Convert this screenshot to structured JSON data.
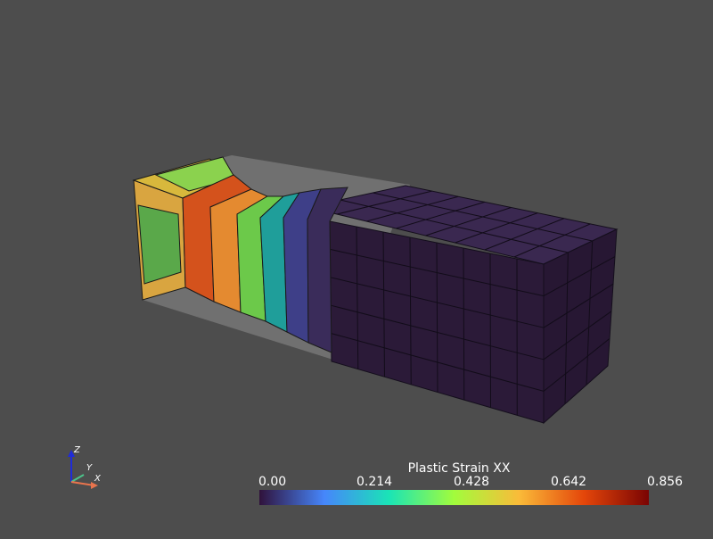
{
  "scalar_bar": {
    "title": "Plastic Strain XX",
    "ticks": [
      "0.00",
      "0.214",
      "0.428",
      "0.642",
      "0.856"
    ],
    "colors": [
      "#30123b",
      "#4686fb",
      "#1ae4b6",
      "#a2fc3c",
      "#fabb39",
      "#e4460a",
      "#7a0403"
    ]
  },
  "axes": {
    "x_label": "X",
    "y_label": "Y",
    "z_label": "Z",
    "x_color": "#e8744d",
    "y_color": "#4cc38a",
    "z_color": "#1f2bd9"
  },
  "scene": {
    "background": "#4d4d4d",
    "mesh_base_color": "#2a1a36"
  }
}
